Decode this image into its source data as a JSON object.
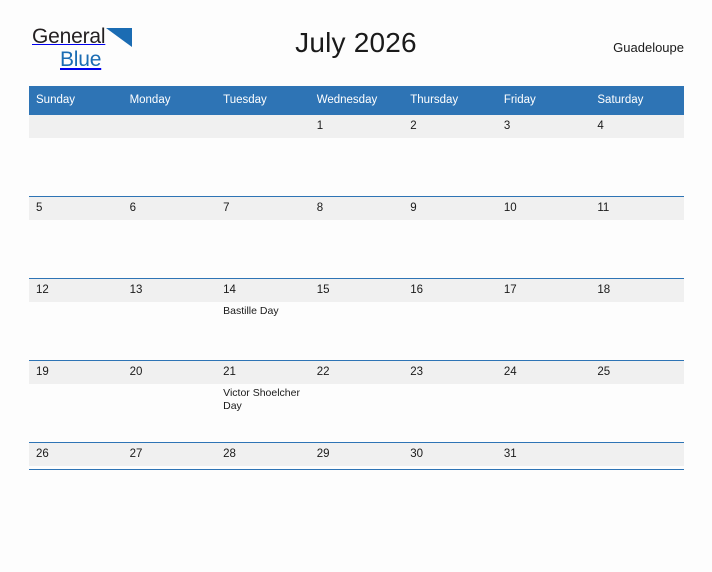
{
  "brand": {
    "word1": "General",
    "word2": "Blue",
    "triangle_color": "#1b6cb3"
  },
  "header": {
    "title": "July 2026",
    "location": "Guadeloupe"
  },
  "theme": {
    "header_blue": "#2e74b5",
    "band_gray": "#f0f0f0",
    "page_background": "#fdfdfd",
    "text_color": "#1a1a1a"
  },
  "calendar": {
    "weekday_headers": [
      "Sunday",
      "Monday",
      "Tuesday",
      "Wednesday",
      "Thursday",
      "Friday",
      "Saturday"
    ],
    "weeks": [
      [
        {
          "date": "",
          "events": []
        },
        {
          "date": "",
          "events": []
        },
        {
          "date": "",
          "events": []
        },
        {
          "date": "1",
          "events": []
        },
        {
          "date": "2",
          "events": []
        },
        {
          "date": "3",
          "events": []
        },
        {
          "date": "4",
          "events": []
        }
      ],
      [
        {
          "date": "5",
          "events": []
        },
        {
          "date": "6",
          "events": []
        },
        {
          "date": "7",
          "events": []
        },
        {
          "date": "8",
          "events": []
        },
        {
          "date": "9",
          "events": []
        },
        {
          "date": "10",
          "events": []
        },
        {
          "date": "11",
          "events": []
        }
      ],
      [
        {
          "date": "12",
          "events": []
        },
        {
          "date": "13",
          "events": []
        },
        {
          "date": "14",
          "events": [
            "Bastille Day"
          ]
        },
        {
          "date": "15",
          "events": []
        },
        {
          "date": "16",
          "events": []
        },
        {
          "date": "17",
          "events": []
        },
        {
          "date": "18",
          "events": []
        }
      ],
      [
        {
          "date": "19",
          "events": []
        },
        {
          "date": "20",
          "events": []
        },
        {
          "date": "21",
          "events": [
            "Victor Shoelcher Day"
          ]
        },
        {
          "date": "22",
          "events": []
        },
        {
          "date": "23",
          "events": []
        },
        {
          "date": "24",
          "events": []
        },
        {
          "date": "25",
          "events": []
        }
      ],
      [
        {
          "date": "26",
          "events": []
        },
        {
          "date": "27",
          "events": []
        },
        {
          "date": "28",
          "events": []
        },
        {
          "date": "29",
          "events": []
        },
        {
          "date": "30",
          "events": []
        },
        {
          "date": "31",
          "events": []
        },
        {
          "date": "",
          "events": []
        }
      ]
    ]
  }
}
